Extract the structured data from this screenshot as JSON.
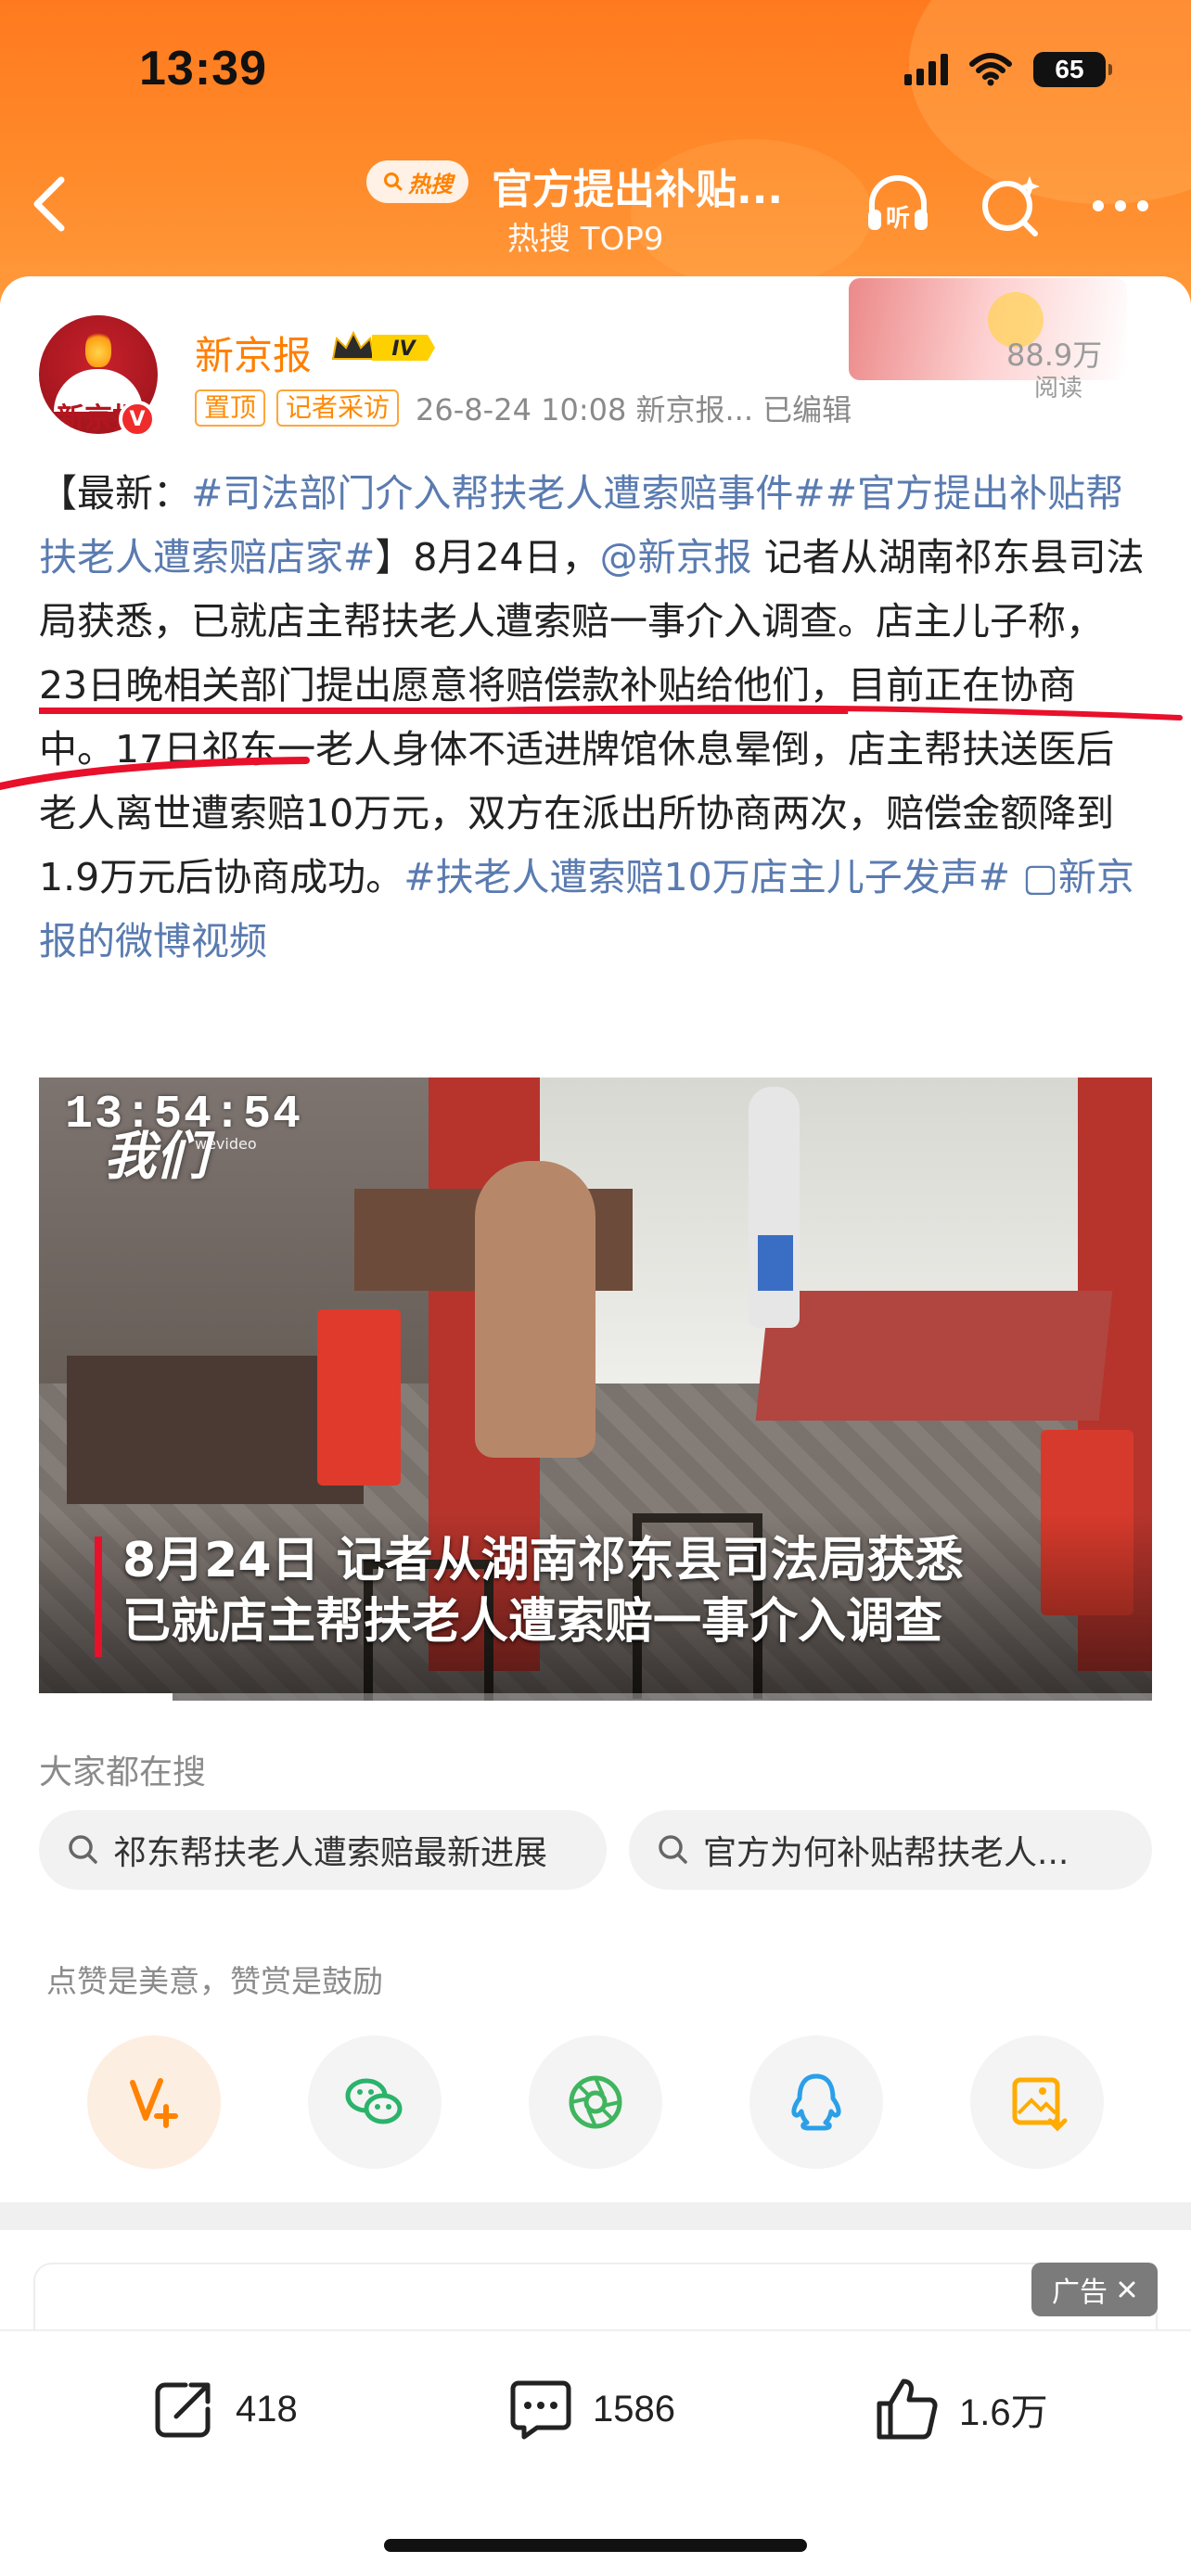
{
  "status_bar": {
    "time": "13:39",
    "battery": "65"
  },
  "header": {
    "hot_badge": "热搜",
    "title": "官方提出补贴...",
    "subtitle": "热搜 TOP9"
  },
  "post": {
    "author": "新京报",
    "avatar_text": "新京报",
    "vip_level": "IV",
    "tags": [
      "置顶",
      "记者采访"
    ],
    "meta": "26-8-24 10:08  新京报...  已编辑",
    "read_count": "88.9万",
    "read_label": "阅读",
    "text": {
      "p1_prefix": "【最新：",
      "hashtag1": "#司法部门介入帮扶老人遭索赔事件#",
      "hashtag2": "#官方提出补贴帮扶老人遭索赔店家#",
      "p1_mid": "】8月24日，",
      "mention": "@新京报",
      "p1_after": " 记者从湖南祁东县司法局获悉，已就店主帮扶老人遭索赔一事介入调查。店主儿子称，",
      "underlined": "23日晚相关部门提出愿意将赔偿款补贴给他们，",
      "p1_rest": "目前正在协商中。17日祁东一老人身体不适进牌馆休息晕倒，店主帮扶送医后老人离世遭索赔10万元，双方在派出所协商两次，赔偿金额降到1.9万元后协商成功。",
      "hashtag3": "#扶老人遭索赔10万店主儿子发声#",
      "video_link": "新京报的微博视频"
    }
  },
  "video": {
    "timestamp": "13:54:54",
    "brand": "我们",
    "brand_sub": "wevideo",
    "caption_line1": "8月24日 记者从湖南祁东县司法局获悉",
    "caption_line2": "已就店主帮扶老人遭索赔一事介入调查",
    "progress": 0.12
  },
  "search": {
    "title": "大家都在搜",
    "chips": [
      "祁东帮扶老人遭索赔最新进展",
      "官方为何补贴帮扶老人..."
    ]
  },
  "like_hint": "点赞是美意，赞赏是鼓励",
  "share_icons": [
    "weibo-v-plus-icon",
    "wechat-icon",
    "moments-icon",
    "qq-icon",
    "save-image-icon"
  ],
  "ad": {
    "label": "广告"
  },
  "actions": {
    "repost": "418",
    "comment": "1586",
    "like": "1.6万"
  },
  "colors": {
    "accent": "#ff7f00",
    "link": "#5a7bb0",
    "underline": "#e8102a"
  }
}
